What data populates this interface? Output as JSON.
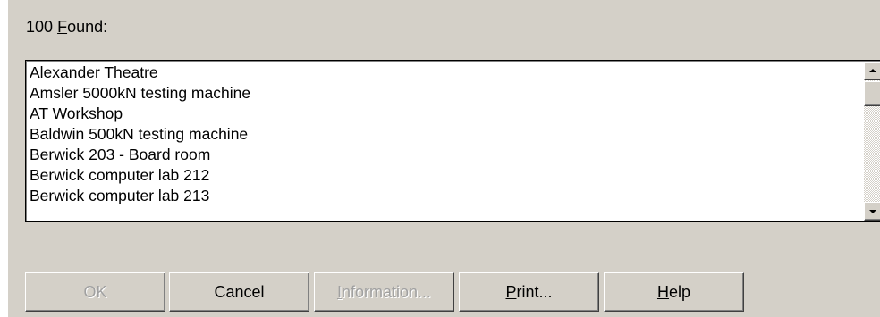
{
  "found": {
    "count": "100",
    "mnemonic": "F",
    "rest": "ound:"
  },
  "list": {
    "items": [
      "Alexander Theatre",
      "Amsler 5000kN testing machine",
      "AT Workshop",
      "Baldwin 500kN testing machine",
      "Berwick 203 - Board room",
      "Berwick computer lab 212",
      "Berwick computer lab 213"
    ],
    "scroll_position": 0.0
  },
  "buttons": {
    "ok": {
      "label": "OK",
      "enabled": false
    },
    "cancel": {
      "label": "Cancel",
      "enabled": true
    },
    "information": {
      "mnemonic": "I",
      "rest": "nformation...",
      "enabled": false
    },
    "print": {
      "mnemonic": "P",
      "rest": "rint...",
      "enabled": true
    },
    "help": {
      "mnemonic": "H",
      "rest": "elp",
      "enabled": true
    }
  },
  "colors": {
    "dialog_bg": "#d4d0c8",
    "list_bg": "#ffffff",
    "disabled_text": "#a0a0a0"
  }
}
